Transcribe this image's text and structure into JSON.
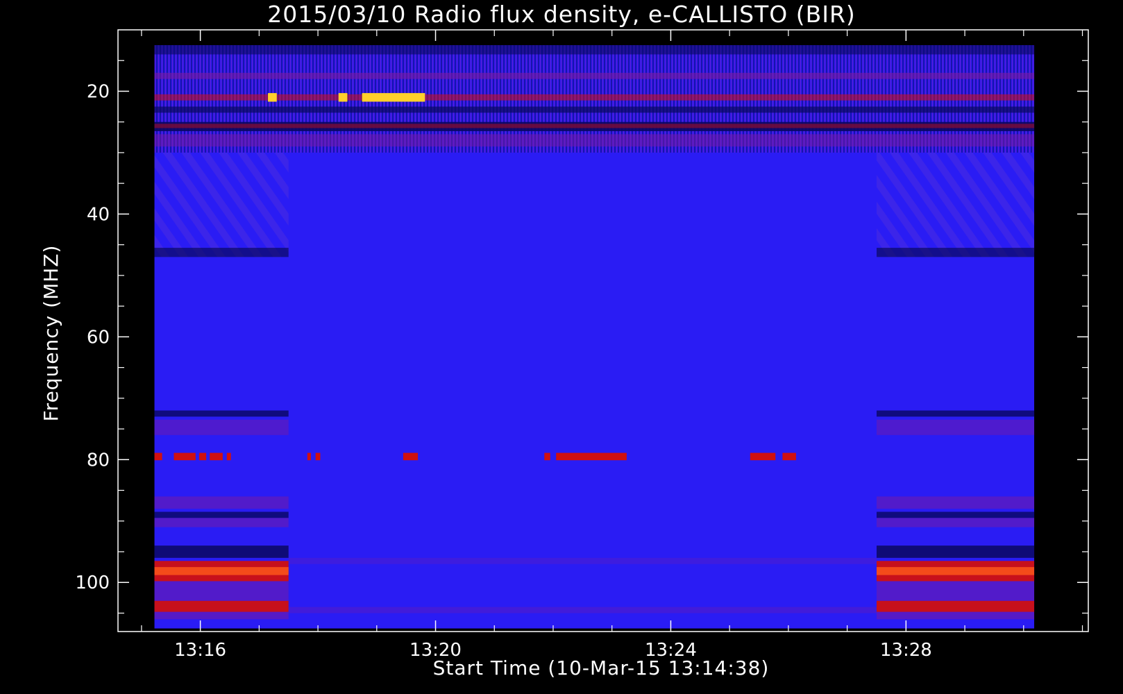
{
  "chart_data": {
    "type": "heatmap",
    "title": "2015/03/10  Radio flux density, e-CALLISTO (BIR)",
    "xlabel": "Start Time (10-Mar-15 13:14:38)",
    "ylabel": "Frequency (MHZ)",
    "x_tick_labels": [
      "13:16",
      "13:20",
      "13:24",
      "13:28"
    ],
    "x_tick_values_min": [
      76,
      80,
      84,
      88
    ],
    "x_range_min": [
      74.6,
      91.1
    ],
    "data_x_range_min": [
      75.22,
      90.18
    ],
    "y_tick_labels": [
      "20",
      "40",
      "60",
      "80",
      "100"
    ],
    "y_tick_values": [
      20,
      40,
      60,
      80,
      100
    ],
    "y_range": [
      10,
      108
    ],
    "y_inverted": true,
    "data_y_range": [
      12.5,
      107.5
    ],
    "colors": {
      "background": "#000000",
      "base": "#2a1cf4",
      "dark": "#0a0860",
      "purple": "#7a1aa0",
      "red": "#d01010",
      "bright": "#ffd02a"
    },
    "bright_band_segments": [
      {
        "freq": 79.5,
        "start_min": 75.22,
        "end_min": 75.35
      },
      {
        "freq": 79.5,
        "start_min": 75.55,
        "end_min": 75.92
      },
      {
        "freq": 79.5,
        "start_min": 75.98,
        "end_min": 76.1
      },
      {
        "freq": 79.5,
        "start_min": 76.16,
        "end_min": 76.38
      },
      {
        "freq": 79.5,
        "start_min": 76.45,
        "end_min": 76.52
      },
      {
        "freq": 79.5,
        "start_min": 77.82,
        "end_min": 77.88
      },
      {
        "freq": 79.5,
        "start_min": 77.96,
        "end_min": 78.04
      },
      {
        "freq": 79.5,
        "start_min": 79.45,
        "end_min": 79.7
      },
      {
        "freq": 79.5,
        "start_min": 81.85,
        "end_min": 81.95
      },
      {
        "freq": 79.5,
        "start_min": 82.05,
        "end_min": 83.25
      },
      {
        "freq": 79.5,
        "start_min": 85.35,
        "end_min": 85.78
      },
      {
        "freq": 79.5,
        "start_min": 85.9,
        "end_min": 86.13
      }
    ],
    "intense_segments": [
      {
        "freq": 21.0,
        "start_min": 78.75,
        "end_min": 79.82
      },
      {
        "freq": 21.0,
        "start_min": 78.35,
        "end_min": 78.5
      },
      {
        "freq": 21.0,
        "start_min": 77.15,
        "end_min": 77.3
      }
    ]
  }
}
